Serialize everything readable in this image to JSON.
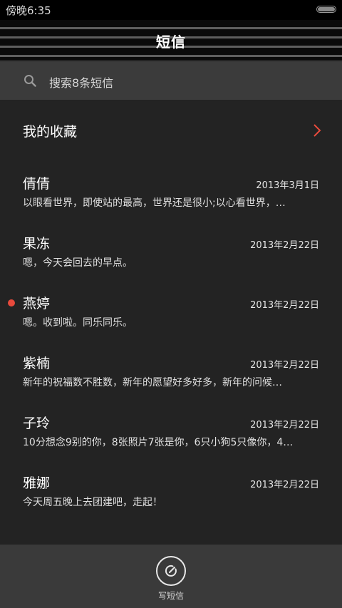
{
  "status_bar": {
    "time": "傍晚6:35"
  },
  "header": {
    "title": "短信"
  },
  "search": {
    "placeholder": "搜索8条短信",
    "icon": "search-icon"
  },
  "favorites": {
    "label": "我的收藏",
    "icon": "chevron-right-icon",
    "icon_color": "#e84a3c"
  },
  "messages": [
    {
      "name": "倩倩",
      "date": "2013年3月1日",
      "preview": "以眼看世界，即使站的最高，世界还是很小;以心看世界，…",
      "unread": false
    },
    {
      "name": "果冻",
      "date": "2013年2月22日",
      "preview": "嗯，今天会回去的早点。",
      "unread": false
    },
    {
      "name": "燕婷",
      "date": "2013年2月22日",
      "preview": "嗯。收到啦。同乐同乐。",
      "unread": true
    },
    {
      "name": "紫楠",
      "date": "2013年2月22日",
      "preview": "新年的祝福数不胜数，新年的愿望好多好多，新年的问候…",
      "unread": false
    },
    {
      "name": "子玲",
      "date": "2013年2月22日",
      "preview": "10分想念9别的你，8张照片7张是你，6只小狗5只像你，4…",
      "unread": false
    },
    {
      "name": "雅娜",
      "date": "2013年2月22日",
      "preview": "今天周五晚上去团建吧，走起！",
      "unread": false
    }
  ],
  "compose": {
    "label": "写短信",
    "icon": "compose-icon"
  },
  "colors": {
    "background": "#232323",
    "accent_unread": "#e84a3c",
    "search_bg": "#3b3b3b",
    "bottom_bar_bg": "#3a3a3a"
  }
}
